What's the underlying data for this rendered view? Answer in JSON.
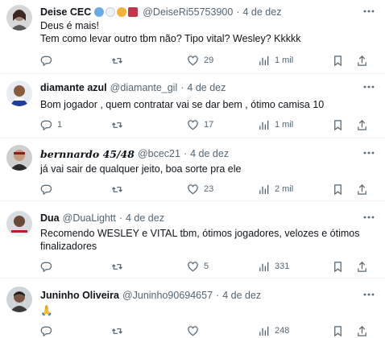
{
  "tweets": [
    {
      "name": "Deise CEC",
      "handle": "@DeiseRi55753900",
      "date": "4 de dez",
      "text_lines": [
        "Deus é mais!",
        "Tem como levar outro tbm não? Tipo vital? Wesley? Kkkkk"
      ],
      "replies": "",
      "retweets": "",
      "likes": "29",
      "views": "1 mil"
    },
    {
      "name": "diamante azul",
      "handle": "@diamante_gil",
      "date": "4 de dez",
      "text_lines": [
        "Bom jogador , quem contratar vai se dar bem , ótimo camisa 10"
      ],
      "replies": "1",
      "retweets": "",
      "likes": "17",
      "views": "1 mil"
    },
    {
      "name": "bernnardo 45/48",
      "handle": "@bcec21",
      "date": "4 de dez",
      "text_lines": [
        "já vai sair de qualquer jeito, boa sorte pra ele"
      ],
      "replies": "",
      "retweets": "",
      "likes": "23",
      "views": "2 mil"
    },
    {
      "name": "Dua",
      "handle": "@DuaLightt",
      "date": "4 de dez",
      "text_lines": [
        "Recomendo WESLEY e VITAL tbm, ótimos jogadores, velozes e ótimos",
        "finalizadores"
      ],
      "replies": "",
      "retweets": "",
      "likes": "5",
      "views": "331"
    },
    {
      "name": "Juninho Oliveira",
      "handle": "@Juninho90694657",
      "date": "4 de dez",
      "text_lines": [
        "🙏"
      ],
      "replies": "",
      "retweets": "",
      "likes": "",
      "views": "248"
    }
  ],
  "colors": {
    "text": "#0f1419",
    "muted": "#536471",
    "divider": "#eff3f4"
  }
}
